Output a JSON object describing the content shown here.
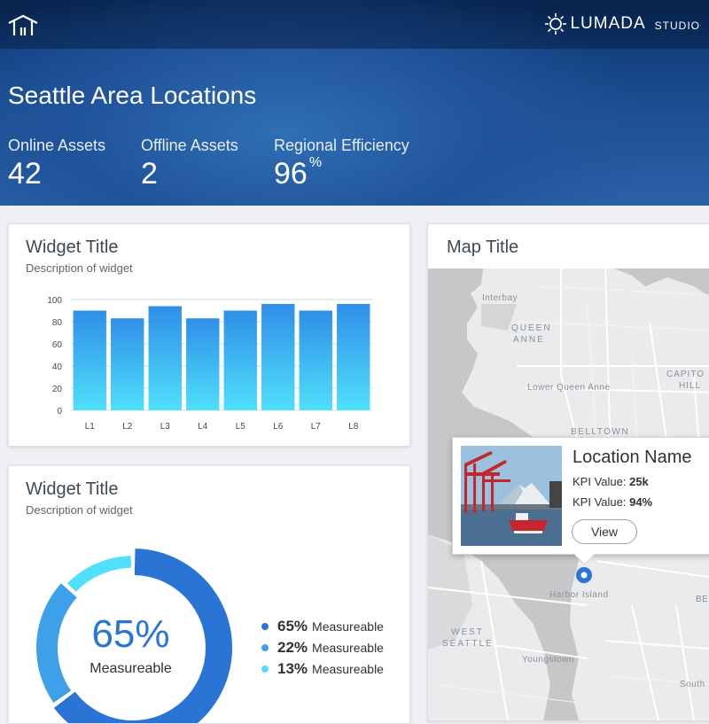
{
  "header": {
    "brand_name": "LUMADA",
    "brand_sub": "STUDIO",
    "title": "Seattle Area Locations",
    "stats": [
      {
        "label": "Online Assets",
        "value": "42",
        "unit": ""
      },
      {
        "label": "Offline Assets",
        "value": "2",
        "unit": ""
      },
      {
        "label": "Regional Efficiency",
        "value": "96",
        "unit": "%"
      }
    ]
  },
  "widget1": {
    "title": "Widget Title",
    "description": "Description of widget",
    "chart_data": {
      "type": "bar",
      "categories": [
        "L1",
        "L2",
        "L3",
        "L4",
        "L5",
        "L6",
        "L7",
        "L8"
      ],
      "values": [
        90,
        83,
        94,
        83,
        90,
        96,
        90,
        96
      ],
      "ylim": [
        0,
        100
      ],
      "yticks": [
        0,
        20,
        40,
        60,
        80,
        100
      ],
      "title": "",
      "xlabel": "",
      "ylabel": "",
      "colors": {
        "bar_top": "#2f8fe8",
        "bar_bottom": "#4fe0fb"
      }
    }
  },
  "widget2": {
    "title": "Widget Title",
    "description": "Description of widget",
    "center_value": "65%",
    "center_label": "Measureable",
    "chart_data": {
      "type": "pie",
      "labels": [
        "Measureable",
        "Measureable",
        "Measureable"
      ],
      "values": [
        65,
        22,
        13
      ],
      "colors": [
        "#2a74d6",
        "#3ea0e8",
        "#4fe0fb"
      ]
    },
    "legend": [
      {
        "pct": "65%",
        "label": "Measureable",
        "color": "#2a74d6"
      },
      {
        "pct": "22%",
        "label": "Measureable",
        "color": "#3ea0e8"
      },
      {
        "pct": "13%",
        "label": "Measureable",
        "color": "#4fe0fb"
      }
    ]
  },
  "map": {
    "title": "Map Title",
    "labels": [
      "Interbay",
      "QUEEN",
      "ANNE",
      "CAPITO",
      "HILL",
      "Lower Queen Anne",
      "BELLTOWN",
      "Harbor Island",
      "WEST",
      "SEATTLE",
      "Youngstown",
      "BE",
      "South"
    ],
    "popup": {
      "name": "Location Name",
      "kpis": [
        {
          "label": "KPI Value:",
          "value": "25k"
        },
        {
          "label": "KPI Value:",
          "value": "94%"
        }
      ],
      "button": "View"
    }
  },
  "icons": [
    "home-icon",
    "lumada-logo-icon",
    "map-pin-icon"
  ]
}
